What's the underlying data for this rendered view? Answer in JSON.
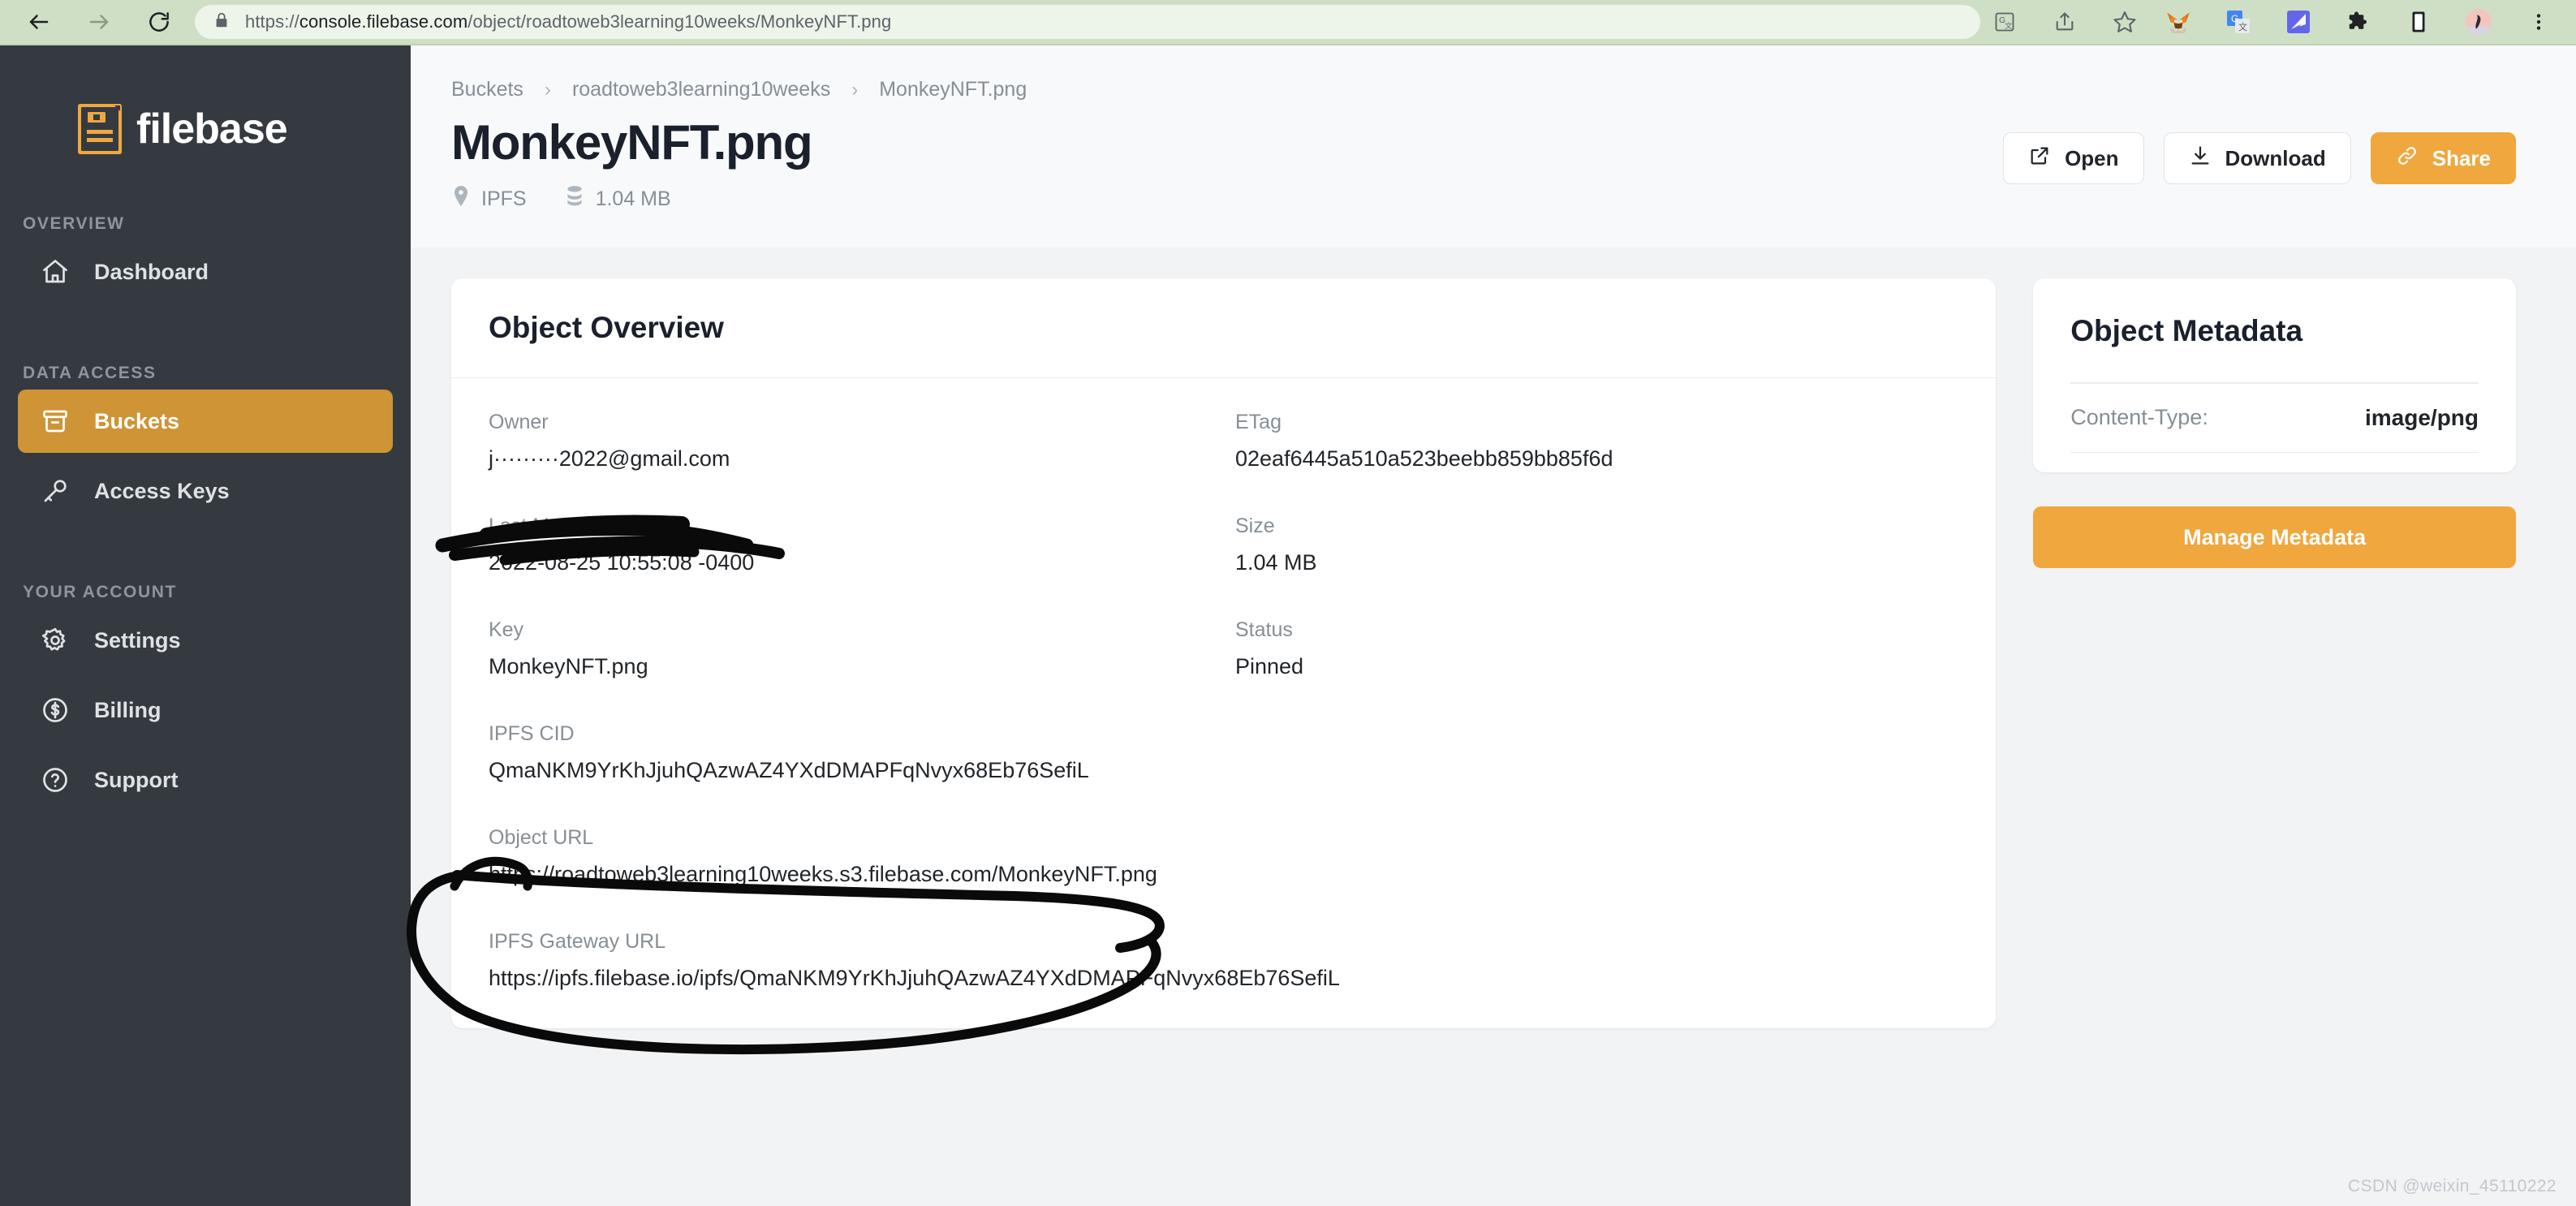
{
  "browser": {
    "url_prefix": "https://",
    "url_domain": "console.filebase.com",
    "url_path": "/object/roadtoweb3learning10weeks/MonkeyNFT.png",
    "back_icon": "back-arrow-icon",
    "forward_icon": "forward-arrow-icon",
    "reload_icon": "reload-icon",
    "lock_icon": "lock-icon",
    "extensions": [
      {
        "name": "translate-page-icon"
      },
      {
        "name": "share-icon"
      },
      {
        "name": "bookmark-star-icon"
      },
      {
        "name": "metamask-extension-icon"
      },
      {
        "name": "google-translate-extension-icon"
      },
      {
        "name": "blue-extension-icon"
      },
      {
        "name": "puzzle-extensions-icon"
      },
      {
        "name": "reading-list-icon"
      },
      {
        "name": "profile-avatar-icon"
      },
      {
        "name": "chrome-menu-icon"
      }
    ]
  },
  "sidebar": {
    "brand": "filebase",
    "sections": [
      {
        "title": "OVERVIEW",
        "items": [
          {
            "label": "Dashboard",
            "icon": "home-icon",
            "active": false
          }
        ]
      },
      {
        "title": "DATA ACCESS",
        "items": [
          {
            "label": "Buckets",
            "icon": "bucket-icon",
            "active": true
          },
          {
            "label": "Access Keys",
            "icon": "key-icon",
            "active": false
          }
        ]
      },
      {
        "title": "YOUR ACCOUNT",
        "items": [
          {
            "label": "Settings",
            "icon": "gear-icon",
            "active": false
          },
          {
            "label": "Billing",
            "icon": "dollar-circle-icon",
            "active": false
          },
          {
            "label": "Support",
            "icon": "question-circle-icon",
            "active": false
          }
        ]
      }
    ]
  },
  "header": {
    "breadcrumb": [
      "Buckets",
      "roadtoweb3learning10weeks",
      "MonkeyNFT.png"
    ],
    "title": "MonkeyNFT.png",
    "network_label": "IPFS",
    "size_label": "1.04 MB",
    "network_icon": "location-pin-icon",
    "size_icon": "database-stack-icon",
    "buttons": {
      "open": "Open",
      "download": "Download",
      "share": "Share",
      "open_icon": "external-link-icon",
      "download_icon": "download-icon",
      "share_icon": "link-chain-icon"
    }
  },
  "overview": {
    "card_title": "Object Overview",
    "fields": {
      "owner_label": "Owner",
      "owner_value": "j·········2022@gmail.com",
      "etag_label": "ETag",
      "etag_value": "02eaf6445a510a523beebb859bb85f6d",
      "last_modified_label": "Last Modified",
      "last_modified_value": "2022-08-25 10:55:08 -0400",
      "size_label": "Size",
      "size_value": "1.04 MB",
      "key_label": "Key",
      "key_value": "MonkeyNFT.png",
      "status_label": "Status",
      "status_value": "Pinned",
      "cid_label": "IPFS CID",
      "cid_value": "QmaNKM9YrKhJjuhQAzwAZ4YXdDMAPFqNvyx68Eb76SefiL",
      "object_url_label": "Object URL",
      "object_url_value": "https://roadtoweb3learning10weeks.s3.filebase.com/MonkeyNFT.png",
      "gateway_url_label": "IPFS Gateway URL",
      "gateway_url_value": "https://ipfs.filebase.io/ipfs/QmaNKM9YrKhJjuhQAzwAZ4YXdDMAPFqNvyx68Eb76SefiL"
    }
  },
  "metadata": {
    "card_title": "Object Metadata",
    "content_type_key": "Content-Type:",
    "content_type_value": "image/png",
    "manage_button": "Manage Metadata"
  },
  "watermark": "CSDN @weixin_45110222",
  "colors": {
    "sidebar_bg": "#343a40",
    "accent_orange": "#f0a73e",
    "active_nav": "#cf9435",
    "content_bg": "#f1f3f5",
    "browser_bar": "#cfdfc6"
  }
}
